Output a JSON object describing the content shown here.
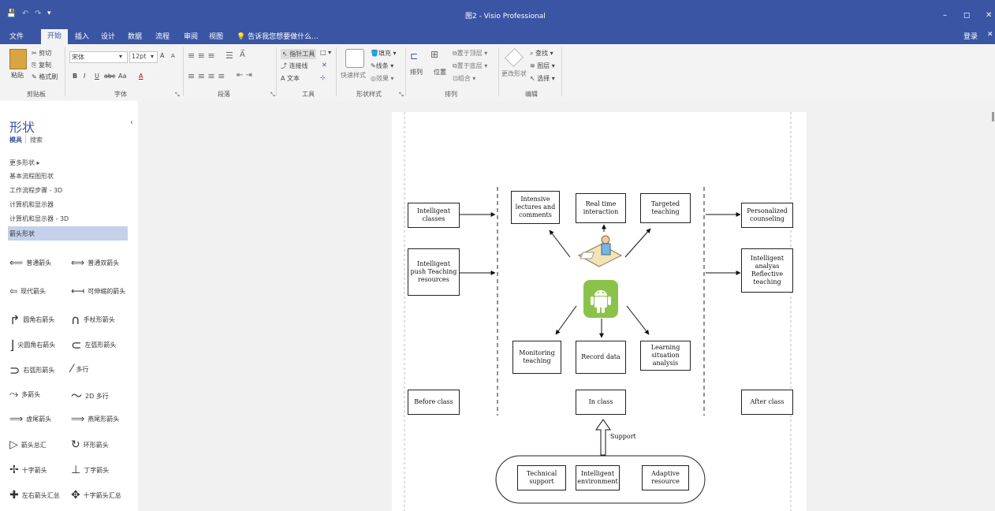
{
  "window": {
    "title": "图2 - Visio Professional",
    "controls": [
      "–",
      "◻",
      "✕"
    ],
    "quick_access": [
      "💾",
      "↶",
      "↷",
      "▾"
    ]
  },
  "menu": {
    "tabs": [
      "文件",
      "开始",
      "插入",
      "设计",
      "数据",
      "流程",
      "审阅",
      "视图"
    ],
    "active_tab": "开始",
    "tellme": "告诉我您想要做什么...",
    "login": "登录",
    "close": "✕"
  },
  "ribbon": {
    "clipboard": {
      "paste": "粘贴",
      "cut": "剪切",
      "copy": "复制",
      "format_painter": "格式刷",
      "label": "剪贴板"
    },
    "font": {
      "name": "宋体",
      "size": "12pt",
      "grow": "A",
      "shrink": "A",
      "bold": "B",
      "italic": "I",
      "underline": "U",
      "strike": "abc",
      "case": "Aa",
      "color": "A",
      "label": "字体"
    },
    "paragraph": {
      "label": "段落"
    },
    "tools": {
      "pointer": "指针工具",
      "connector": "连接线",
      "text": "A 文本",
      "label": "工具"
    },
    "shape_styles": {
      "quick": "快速样式",
      "fill": "填充",
      "line": "线条",
      "effects": "效果",
      "label": "形状样式"
    },
    "arrange": {
      "arrange": "排列",
      "position": "位置",
      "bring_front": "置于顶层",
      "send_back": "置于底层",
      "group": "组合",
      "label": "排列"
    },
    "editing": {
      "change_shape": "更改形状",
      "find": "查找",
      "layers": "图层",
      "select": "选择",
      "label": "编辑"
    }
  },
  "shapes_pane": {
    "title": "形状",
    "collapse": "‹",
    "tab_stencils": "模具",
    "tab_search": "搜索",
    "more_shapes": "更多形状",
    "stencils": [
      "基本流程图形状",
      "工作流程步骤 - 3D",
      "计算机和显示器",
      "计算机和显示器 - 3D",
      "箭头形状"
    ],
    "selected_stencil": "箭头形状",
    "items": [
      [
        "普通箭头",
        "普通双箭头"
      ],
      [
        "现代箭头",
        "可伸缩的箭头"
      ],
      [
        "圆角右箭头",
        "手杖形箭头"
      ],
      [
        "尖圆角右箭头",
        "左弧形箭头"
      ],
      [
        "右弧形箭头",
        "多行"
      ],
      [
        "多箭头",
        "2D 多行"
      ],
      [
        "虚尾箭头",
        "燕尾形箭头"
      ],
      [
        "箭头总汇",
        "环形箭头"
      ],
      [
        "十字箭头",
        "丁字箭头"
      ],
      [
        "左右箭头汇总",
        "十字箭头汇总"
      ]
    ]
  },
  "diagram": {
    "left_boxes": [
      "Intelligent classes",
      "Intelligent push Teaching resources"
    ],
    "top_boxes": [
      "Intensive lectures and comments",
      "Real time interaction",
      "Targeted teaching"
    ],
    "right_boxes": [
      "Personalized counseling",
      "Intelligent analyas Reflective teaching"
    ],
    "bottom_boxes": [
      "Monitoring teaching",
      "Record data",
      "Learning situation analysis"
    ],
    "phases": [
      "Before class",
      "In class",
      "After class"
    ],
    "support_label": "Support",
    "support_boxes": [
      "Technical support",
      "Intelligent environment",
      "Adaptive resource"
    ]
  },
  "colors": {
    "accent": "#3955a3",
    "android": "#8bc34a"
  }
}
